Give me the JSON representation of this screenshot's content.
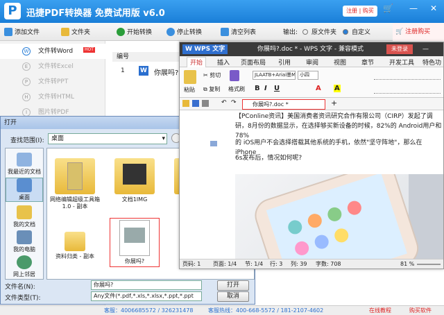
{
  "app": {
    "logo": "P",
    "title": "迅捷PDF转换器 免费试用版 v6.0",
    "register": "注册 | 购买",
    "win_controls": [
      "🛒",
      "—",
      "✕"
    ]
  },
  "toolbar": {
    "add_file": "添加文件",
    "add_folder": "文件夹",
    "start": "开始转换",
    "stop": "停止转换",
    "clear": "清空列表",
    "output_label": "输出:",
    "output_original": "原文件夹",
    "output_custom": "自定义",
    "buy": "注册购买"
  },
  "sidebar": {
    "items": [
      {
        "label": "文件转Word",
        "icon": "W",
        "hot": "HOT"
      },
      {
        "label": "文件转Excel",
        "icon": "E"
      },
      {
        "label": "文件转PPT",
        "icon": "P"
      },
      {
        "label": "文件转HTML",
        "icon": "H"
      },
      {
        "label": "图片转PDF",
        "icon": "I"
      }
    ]
  },
  "list": {
    "header": "编号",
    "rows": [
      {
        "num": "1",
        "name": "你展吗?"
      }
    ]
  },
  "footer": {
    "qq": "客服：4006685572 / 326231478",
    "phone": "客服热线：400-668-5572 / 181-2107-4602",
    "tutorial": "在线教程",
    "buy": "购买软件"
  },
  "dialog": {
    "title": "打开",
    "close": "✕",
    "look_in_label": "查找范围(I):",
    "look_in": "桌面",
    "places": [
      {
        "label": "我最近的文档"
      },
      {
        "label": "桌面"
      },
      {
        "label": "我的文档"
      },
      {
        "label": "我的电脑"
      },
      {
        "label": "网上邻居"
      }
    ],
    "files": [
      {
        "label": "网络编辑超级工具箱 1.0 - 副本"
      },
      {
        "label": "文档1IMG"
      },
      {
        "label": ""
      },
      {
        "label": "资料归类 - 副本"
      },
      {
        "label": "你展吗?"
      }
    ],
    "filename_label": "文件名(N):",
    "filename": "你展吗?",
    "filetype_label": "文件类型(T):",
    "filetype": "Any文件(*.pdf,*.xls,*.xlsx,*.ppt,*.ppt",
    "open": "打开",
    "cancel": "取消"
  },
  "wps": {
    "logo": "W WPS 文字",
    "title": "你展吗?.doc * - WPS 文字 - 兼容模式",
    "login": "未登录",
    "tabs": [
      "开始",
      "插入",
      "页面布局",
      "引用",
      "审阅",
      "视图",
      "章节",
      "开发工具",
      "特色功能"
    ],
    "ribbon": {
      "paste": "粘贴",
      "cut": "剪切",
      "copy": "复制",
      "format_painter": "格式刷",
      "font": "JLAATB+Arial墨ML",
      "size": "小四"
    },
    "doc_tab": "你展吗?.doc *",
    "paragraphs": [
      "【PConline资讯】美国消费者资讯研究合作有限公司（CIRP）发起了调研，8月份的数据显示，在选择够买新设备的时候，82%的  Android用户和  78%",
      "的  iOS用户不会选择搭载其他系统的手机，依然\"坚守阵地\"，那么在  iPhone",
      "6s发布后，情况如何呢?"
    ],
    "status": {
      "page": "页码: 1",
      "pages": "页面: 1/4",
      "section": "节: 1/4",
      "row": "行: 3",
      "col": "列: 39",
      "words": "字数: 708",
      "zoom": "81 %"
    }
  }
}
